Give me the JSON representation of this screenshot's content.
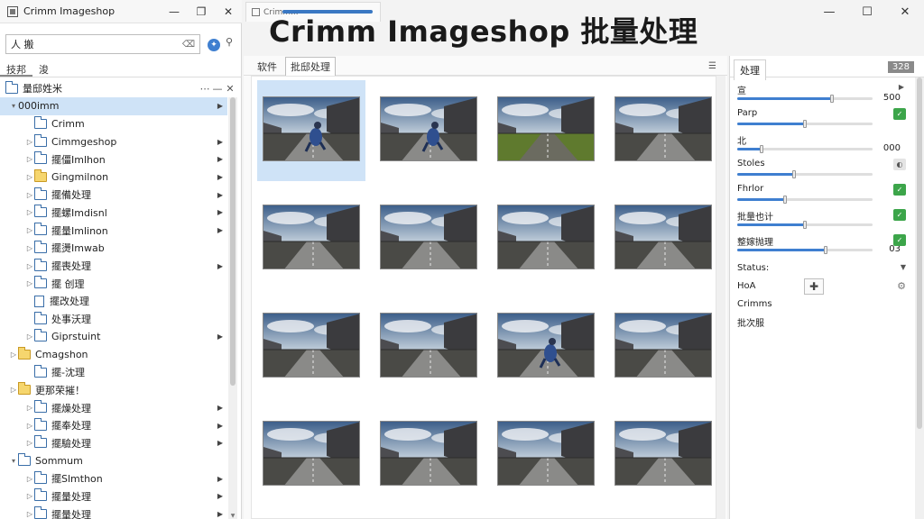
{
  "window": {
    "app_title": "Crimm Imageshop",
    "headline": "Crimm Imageshop 批量处理",
    "doc_tab": "Crimm..."
  },
  "left": {
    "search_value": "人 搬",
    "tabs": [
      "技邦",
      "浚"
    ],
    "tree_header": "量邸姓米",
    "items": [
      {
        "label": "000imm",
        "level": 0,
        "icon": "none",
        "chevron": "down",
        "arrow": true,
        "selected": true
      },
      {
        "label": "Crimm",
        "level": 1,
        "icon": "folder",
        "chevron": "none",
        "arrow": false
      },
      {
        "label": "Cimmgeshop",
        "level": 1,
        "icon": "folder",
        "chevron": "right",
        "arrow": true
      },
      {
        "label": "擺僵Imlhon",
        "level": 1,
        "icon": "folder",
        "chevron": "right",
        "arrow": true
      },
      {
        "label": "Gingmilnon",
        "level": 1,
        "icon": "folder-yellow",
        "chevron": "right",
        "arrow": true
      },
      {
        "label": "擺備处理",
        "level": 1,
        "icon": "folder",
        "chevron": "right",
        "arrow": true
      },
      {
        "label": "擺螺Imdisnl",
        "level": 1,
        "icon": "folder",
        "chevron": "right",
        "arrow": true
      },
      {
        "label": "擺量Imlinon",
        "level": 1,
        "icon": "folder",
        "chevron": "right",
        "arrow": true
      },
      {
        "label": "擺燙Imwab",
        "level": 1,
        "icon": "folder",
        "chevron": "right",
        "arrow": false
      },
      {
        "label": "擺喪处理",
        "level": 1,
        "icon": "folder",
        "chevron": "right",
        "arrow": true
      },
      {
        "label": "擺 创理",
        "level": 1,
        "icon": "folder",
        "chevron": "right",
        "arrow": false
      },
      {
        "label": "擺改处理",
        "level": 1,
        "icon": "file",
        "chevron": "none",
        "arrow": false
      },
      {
        "label": "处事沃理",
        "level": 1,
        "icon": "folder",
        "chevron": "none",
        "arrow": false
      },
      {
        "label": "Giprstuint",
        "level": 1,
        "icon": "folder",
        "chevron": "right",
        "arrow": true
      },
      {
        "label": "Cmagshon",
        "level": 0,
        "icon": "folder-yellow",
        "chevron": "right",
        "arrow": false
      },
      {
        "label": "擺-沈理",
        "level": 1,
        "icon": "folder",
        "chevron": "none",
        "arrow": false
      },
      {
        "label": "更那荣摧！",
        "level": 0,
        "icon": "folder-yellow",
        "chevron": "right",
        "arrow": false
      },
      {
        "label": "擺燥处理",
        "level": 1,
        "icon": "folder",
        "chevron": "right",
        "arrow": true
      },
      {
        "label": "擺奉处理",
        "level": 1,
        "icon": "folder",
        "chevron": "right",
        "arrow": true
      },
      {
        "label": "擺驗处理",
        "level": 1,
        "icon": "folder",
        "chevron": "right",
        "arrow": true
      },
      {
        "label": "Sommum",
        "level": 0,
        "icon": "folder",
        "chevron": "down",
        "arrow": false
      },
      {
        "label": "擺Slmthon",
        "level": 1,
        "icon": "folder",
        "chevron": "right",
        "arrow": true
      },
      {
        "label": "擺量处理",
        "level": 1,
        "icon": "folder",
        "chevron": "right",
        "arrow": true
      },
      {
        "label": "擺量处理",
        "level": 1,
        "icon": "folder",
        "chevron": "right",
        "arrow": true
      }
    ]
  },
  "center": {
    "tabs": [
      "软件",
      "批邸处理"
    ],
    "active_tab": 1,
    "thumbnails": [
      {
        "scene": "person"
      },
      {
        "scene": "person"
      },
      {
        "scene": "green"
      },
      {
        "scene": "road"
      },
      {
        "scene": "road"
      },
      {
        "scene": "road"
      },
      {
        "scene": "road"
      },
      {
        "scene": "road"
      },
      {
        "scene": "road"
      },
      {
        "scene": "road"
      },
      {
        "scene": "person"
      },
      {
        "scene": "road"
      },
      {
        "scene": "road"
      },
      {
        "scene": "road"
      },
      {
        "scene": "road"
      },
      {
        "scene": "road"
      }
    ],
    "selected_index": 0
  },
  "right": {
    "tab": "处理",
    "count": "328",
    "props": [
      {
        "label": "宣",
        "value": "500",
        "level": 0.7,
        "button": "arrow"
      },
      {
        "label": "Parp",
        "value": "",
        "level": 0.5,
        "button": "green"
      },
      {
        "label": "北",
        "value": "000",
        "level": 0.18,
        "button": "none"
      },
      {
        "label": "Stoles",
        "value": "",
        "level": 0.42,
        "button": "grey"
      },
      {
        "label": "Fhrlor",
        "value": "",
        "level": 0.35,
        "button": "green"
      },
      {
        "label": "批量也计",
        "value": "",
        "level": 0.5,
        "button": "green"
      },
      {
        "label": "整嫁抛理",
        "value": "03",
        "level": 0.65,
        "button": "green"
      }
    ],
    "status_label": "Status:",
    "mode_label": "HoA",
    "line1": "Crimms",
    "line2": "批次服"
  }
}
